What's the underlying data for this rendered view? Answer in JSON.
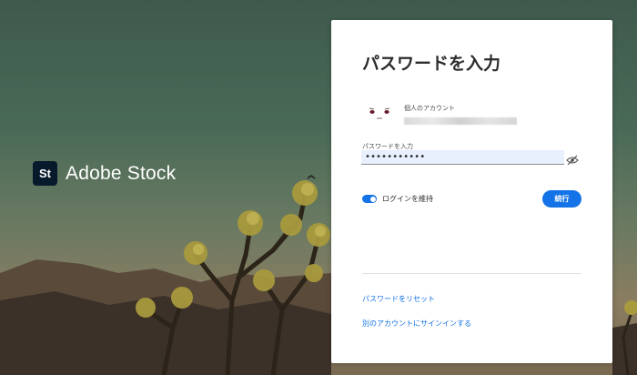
{
  "brand": {
    "logo_text": "St",
    "name": "Adobe Stock",
    "logo_color": "#071a2b"
  },
  "card": {
    "title": "パスワードを入力",
    "account_label": "個人のアカウント",
    "password_label": "パスワードを入力",
    "password_value": "•••••••••••",
    "keep_signed_in_label": "ログインを維持",
    "keep_signed_in_enabled": true,
    "continue_label": "続行",
    "reset_password_link": "パスワードをリセット",
    "other_account_link": "別のアカウントにサインインする"
  },
  "icons": {
    "show_password": "eye-slash-icon",
    "avatar": "avatar-face-icon"
  },
  "colors": {
    "accent": "#1473e6",
    "input_bg": "#e8f0fe",
    "card_bg": "#ffffff"
  }
}
